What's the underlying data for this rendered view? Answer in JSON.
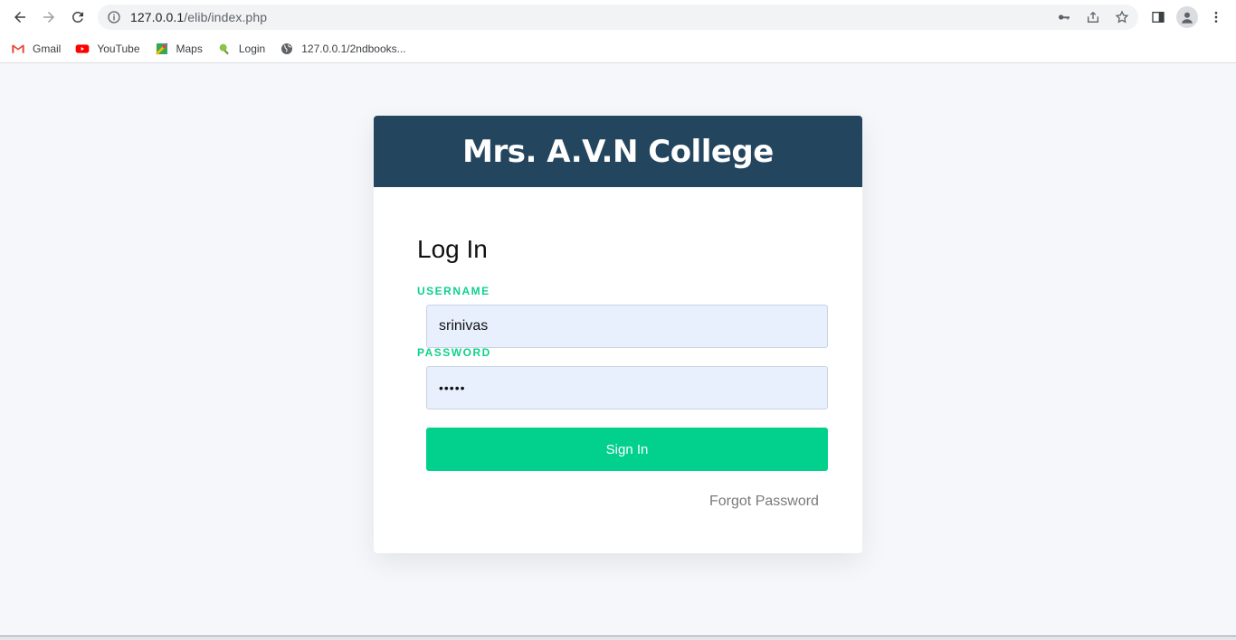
{
  "browser": {
    "url_host": "127.0.0.1",
    "url_path": "/elib/index.php",
    "bookmarks": [
      {
        "label": "Gmail",
        "icon": "gmail-icon"
      },
      {
        "label": "YouTube",
        "icon": "youtube-icon"
      },
      {
        "label": "Maps",
        "icon": "maps-icon"
      },
      {
        "label": "Login",
        "icon": "login-icon"
      },
      {
        "label": "127.0.0.1/2ndbooks...",
        "icon": "globe-icon"
      }
    ]
  },
  "page": {
    "college_name": "Mrs. A.V.N College",
    "heading": "Log In",
    "username_label": "USERNAME",
    "username_value": "srinivas",
    "password_label": "PASSWORD",
    "password_value": "•••••",
    "signin_label": "Sign In",
    "forgot_label": "Forgot Password"
  },
  "colors": {
    "header_bg": "#24455e",
    "accent_green": "#02d18d",
    "field_bg": "#e8f0fe",
    "page_bg": "#f6f7fb"
  }
}
